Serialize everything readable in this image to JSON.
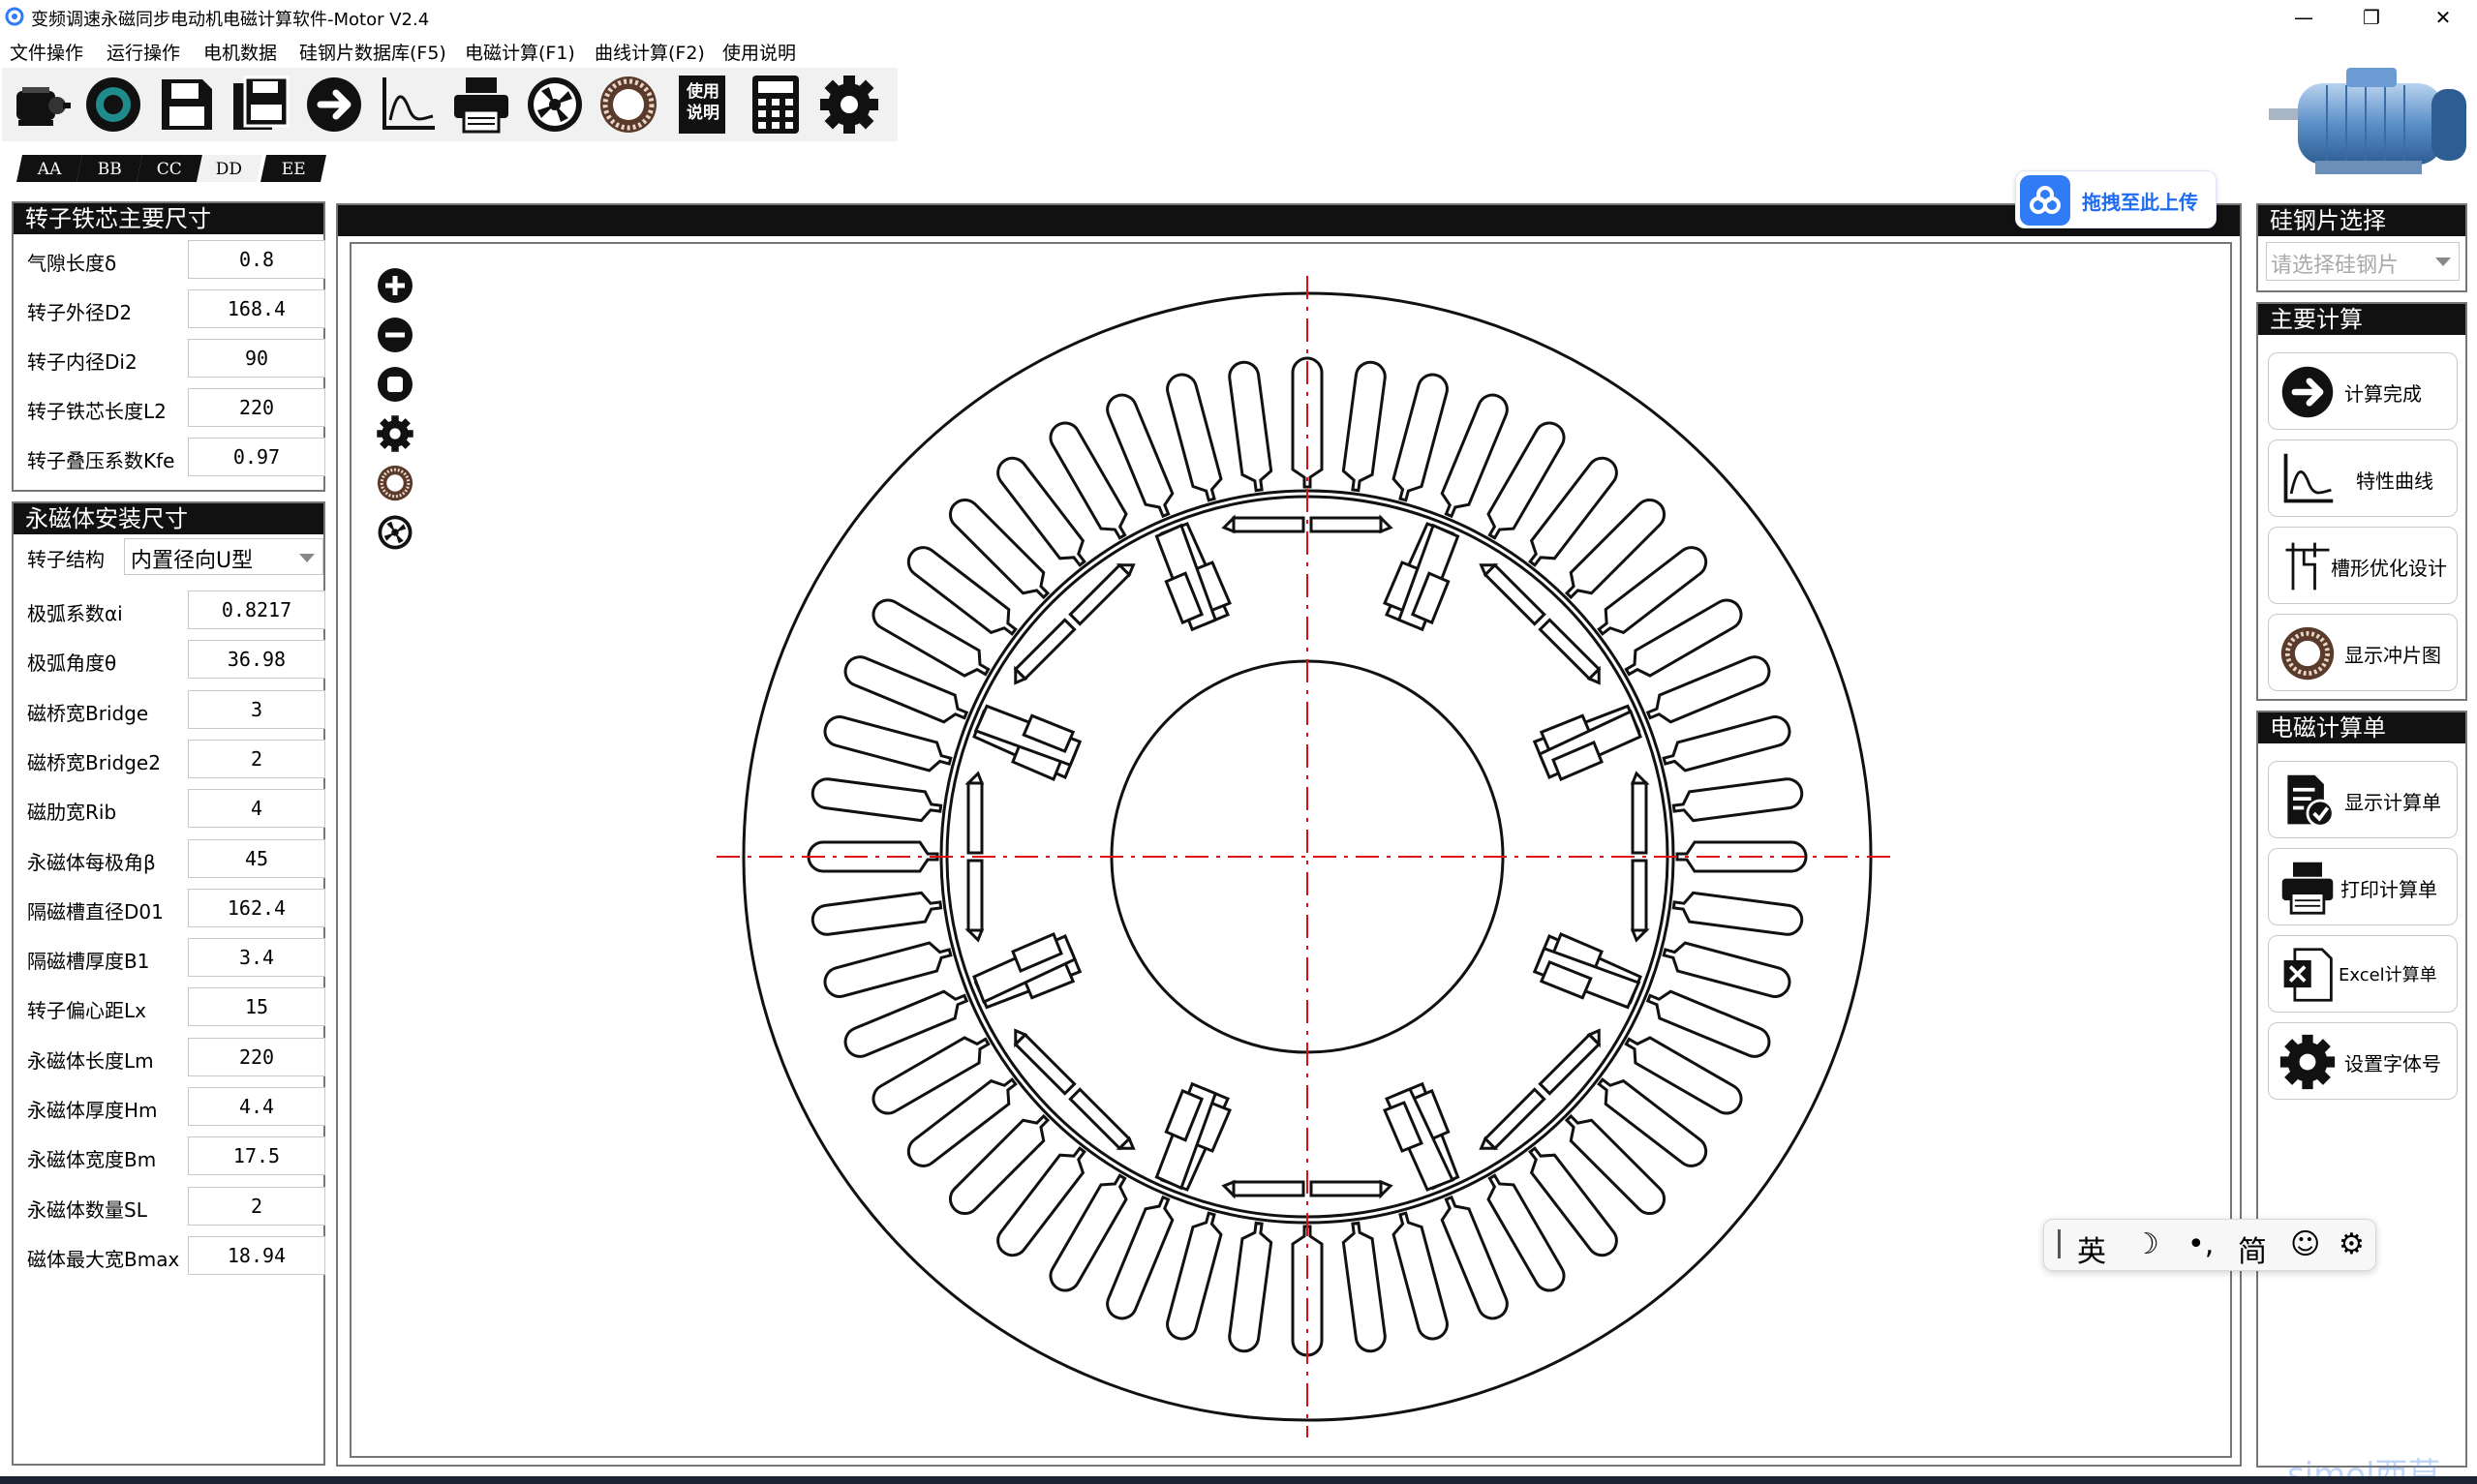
{
  "window": {
    "title": "变频调速永磁同步电动机电磁计算软件-Motor V2.4",
    "minimize": "—",
    "maximize": "❐",
    "close": "✕"
  },
  "menu": [
    "文件操作",
    "运行操作",
    "电机数据",
    "硅钢片数据库(F5)",
    "电磁计算(F1)",
    "曲线计算(F2)",
    "使用说明"
  ],
  "toolbar": {
    "icons": [
      "motor-icon",
      "rotor-ring-icon",
      "save-icon",
      "save-as-icon",
      "arrow-right-icon",
      "curve-icon",
      "print-icon",
      "fan-icon",
      "stator-icon",
      "manual-icon",
      "calculator-icon",
      "gear-icon"
    ],
    "manual_label": "使用说明"
  },
  "tabs": [
    "AA",
    "BB",
    "CC",
    "DD",
    "EE"
  ],
  "active_tab": "DD",
  "rotor_core": {
    "title": "转子铁芯主要尺寸",
    "fields": [
      {
        "label": "气隙长度δ",
        "value": "0.8"
      },
      {
        "label": "转子外径D2",
        "value": "168.4"
      },
      {
        "label": "转子内径Di2",
        "value": "90"
      },
      {
        "label": "转子铁芯长度L2",
        "value": "220"
      },
      {
        "label": "转子叠压系数Kfe",
        "value": "0.97"
      }
    ]
  },
  "magnet": {
    "title": "永磁体安装尺寸",
    "structure_label": "转子结构",
    "structure_value": "内置径向U型",
    "fields": [
      {
        "label": "极弧系数αi",
        "value": "0.8217"
      },
      {
        "label": "极弧角度θ",
        "value": "36.98"
      },
      {
        "label": "磁桥宽Bridge",
        "value": "3"
      },
      {
        "label": "磁桥宽Bridge2",
        "value": "2"
      },
      {
        "label": "磁肋宽Rib",
        "value": "4"
      },
      {
        "label": "永磁体每极角β",
        "value": "45"
      },
      {
        "label": "隔磁槽直径D01",
        "value": "162.4"
      },
      {
        "label": "隔磁槽厚度B1",
        "value": "3.4"
      },
      {
        "label": "转子偏心距Lx",
        "value": "15"
      },
      {
        "label": "永磁体长度Lm",
        "value": "220"
      },
      {
        "label": "永磁体厚度Hm",
        "value": "4.4"
      },
      {
        "label": "永磁体宽度Bm",
        "value": "17.5"
      },
      {
        "label": "永磁体数量SL",
        "value": "2"
      },
      {
        "label": "磁体最大宽Bmax",
        "value": "18.94"
      }
    ]
  },
  "canvas_tools": [
    "zoom-in-icon",
    "zoom-out-icon",
    "stop-icon",
    "gear-icon",
    "stator-icon",
    "fan-icon"
  ],
  "upload": {
    "label": "拖拽至此上传"
  },
  "steel": {
    "title": "硅钢片选择",
    "placeholder": "请选择硅钢片"
  },
  "main_calc": {
    "title": "主要计算",
    "buttons": [
      "计算完成",
      "特性曲线",
      "槽形优化设计",
      "显示冲片图"
    ]
  },
  "em_sheet": {
    "title": "电磁计算单",
    "buttons": [
      "显示计算单",
      "打印计算单",
      "Excel计算单",
      "设置字体号"
    ]
  },
  "ime": {
    "items": [
      "英",
      "☽",
      "•,",
      "简",
      "☺",
      "⚙"
    ]
  },
  "watermark": "simol西莫",
  "colors": {
    "header": "#111111",
    "accent": "#2f7cf6",
    "centerline": "#dd1111"
  },
  "stator": {
    "slots": 48,
    "poles": 8
  }
}
